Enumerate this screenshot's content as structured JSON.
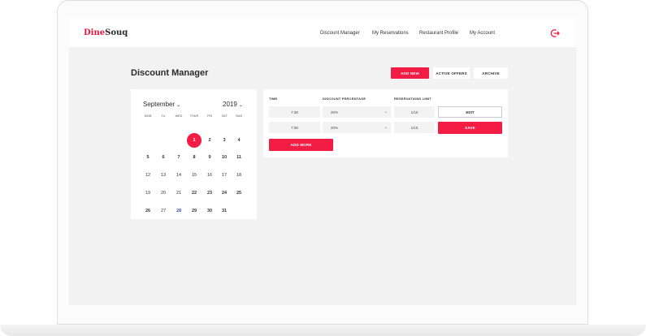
{
  "app": {
    "logo_part1": "Dine",
    "logo_part2": "Souq"
  },
  "nav": {
    "links": [
      "Discount Manager",
      "My Reservations",
      "Restaurant Profile",
      "My Account"
    ],
    "logout_icon": "logout-icon"
  },
  "header": {
    "title": "Discount Manager",
    "add_new": "ADD NEW",
    "active_offers": "ACTIVE OFFERS",
    "archive": "ARCHIVE"
  },
  "calendar": {
    "month": "September",
    "year": "2019",
    "weekdays": [
      "MON",
      "TU",
      "WED",
      "THUR",
      "FRI",
      "SAT",
      "SUN"
    ],
    "weeks": [
      [
        "",
        "",
        "",
        "1",
        "2",
        "3",
        "4"
      ],
      [
        "5",
        "6",
        "7",
        "8",
        "9",
        "10",
        "11"
      ],
      [
        "12",
        "13",
        "14",
        "15",
        "16",
        "17",
        "18"
      ],
      [
        "19",
        "20",
        "21",
        "22",
        "23",
        "24",
        "25"
      ],
      [
        "26",
        "27",
        "28",
        "29",
        "30",
        "31",
        ""
      ]
    ],
    "selected_day": "1",
    "highlight_day": "28",
    "bold_days": [
      "1",
      "2",
      "3",
      "4",
      "5",
      "6",
      "7",
      "8",
      "9",
      "10",
      "11",
      "22",
      "23",
      "24",
      "25",
      "26",
      "28",
      "29",
      "30",
      "31"
    ]
  },
  "offers": {
    "headers": [
      "TIME",
      "DISCOUNT PERCENTAGE",
      "RESERVATIONS LIMIT"
    ],
    "rows": [
      {
        "time": "7:30",
        "discount": "20%",
        "limit": "1/10"
      },
      {
        "time": "7:30",
        "discount": "20%",
        "limit": "1/10"
      }
    ],
    "edit_label": "EDIT",
    "save_label": "SAVE",
    "add_more_label": "ADD MORE"
  },
  "colors": {
    "accent": "#f21c45",
    "background": "#f2f2f2"
  }
}
